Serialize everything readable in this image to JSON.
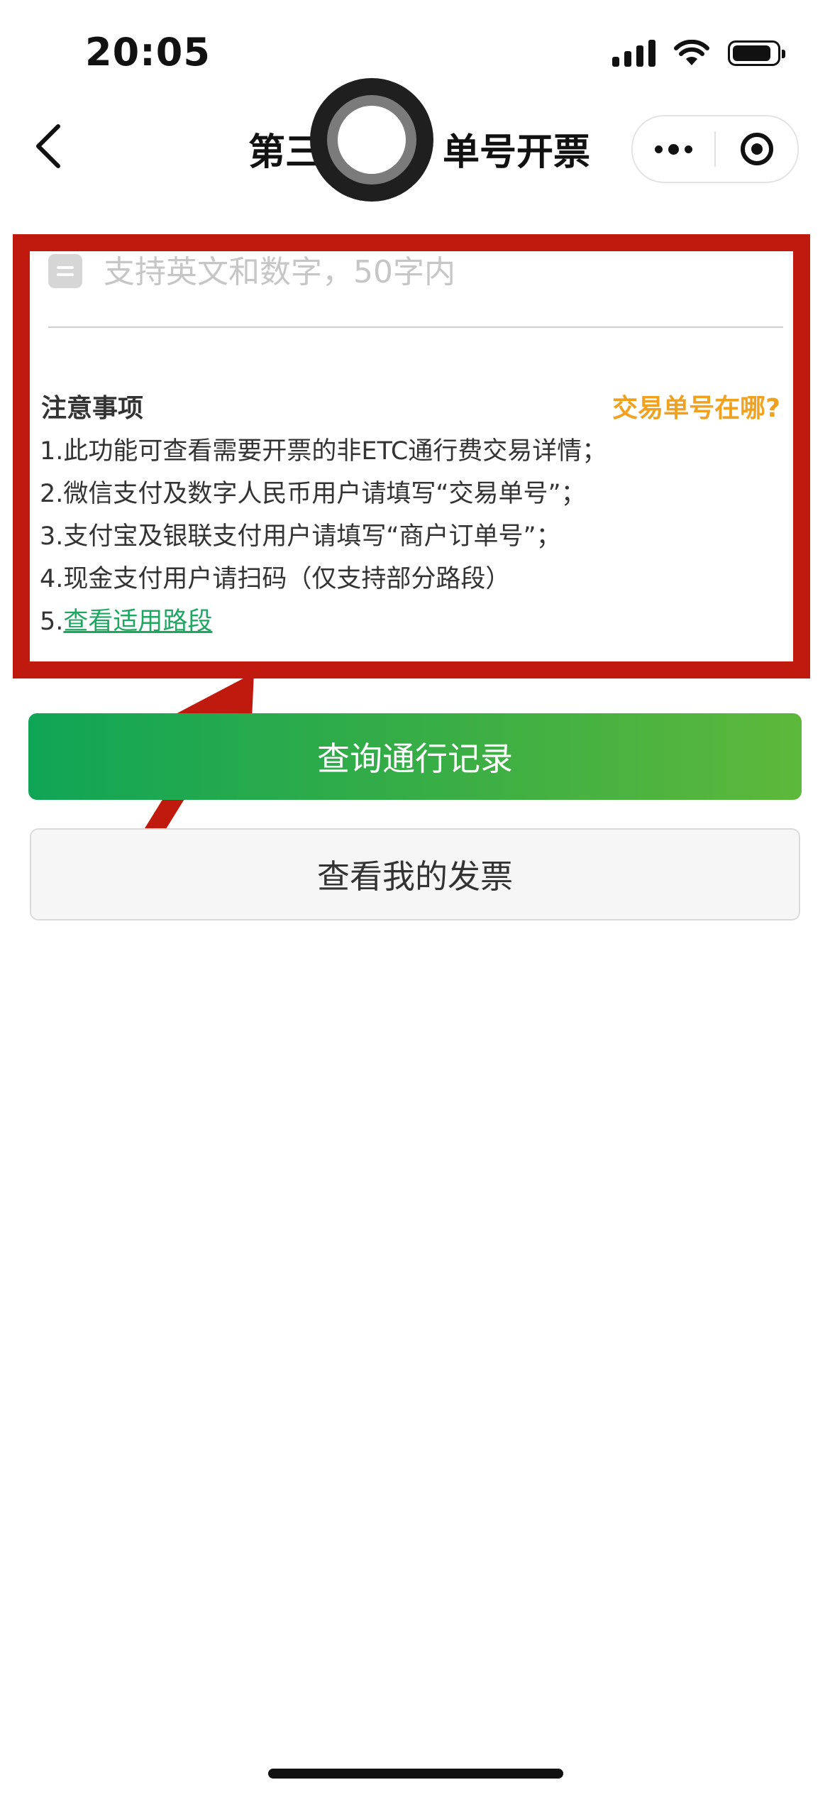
{
  "status_bar": {
    "time": "20:05"
  },
  "nav": {
    "title_left": "第三",
    "title_right": "单号开票"
  },
  "form": {
    "transaction_input_value": "",
    "transaction_input_placeholder": "支持英文和数字，50字内"
  },
  "notice": {
    "title": "注意事项",
    "where_link": "交易单号在哪?",
    "items": [
      "1.此功能可查看需要开票的非ETC通行费交易详情；",
      "2.微信支付及数字人民币用户请填写“交易单号”；",
      "3.支付宝及银联支付用户请填写“商户订单号”；",
      "4.现金支付用户请扫码（仅支持部分路段）"
    ],
    "item5_prefix": "5.",
    "item5_link": "查看适用路段"
  },
  "buttons": {
    "query": "查询通行记录",
    "view_invoices": "查看我的发票"
  },
  "colors": {
    "primary_green": "#10a556",
    "link_orange": "#f0a11f",
    "link_green": "#1ea760",
    "annotation_red": "#c01a0f"
  },
  "icons": [
    "back-icon",
    "more-icon",
    "close-miniprogram-icon",
    "field-icon",
    "wifi-icon",
    "battery-icon",
    "signal-icon"
  ]
}
